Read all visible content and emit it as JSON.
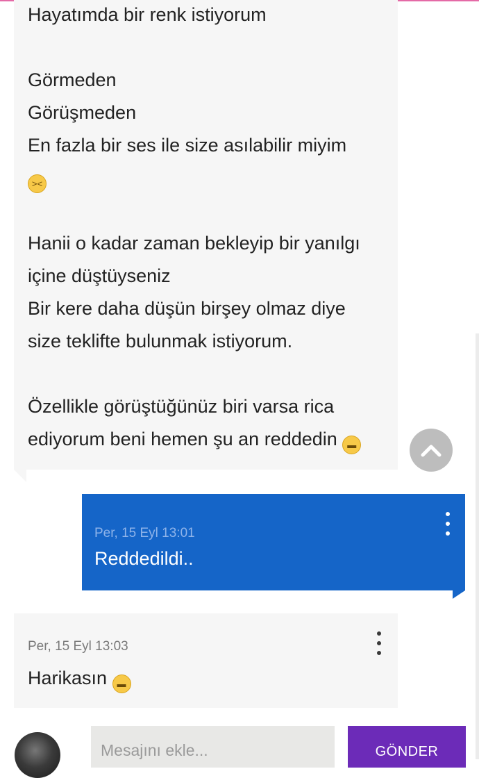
{
  "colors": {
    "accent_top": "#e46aa6",
    "incoming_bubble": "#f6f6f6",
    "outgoing_bubble": "#1565c8",
    "send_button": "#6c2bb8",
    "scroll_top_button": "#bdbdbd"
  },
  "messages": [
    {
      "direction": "incoming",
      "lines": [
        "Hayatımda bir renk istiyorum",
        "",
        "Görmeden",
        "Görüşmeden",
        "En fazla bir ses ile size asılabilir miyim",
        "😂",
        "",
        "Hanii o kadar zaman bekleyip bir yanılgı",
        "içine düştüyseniz",
        "Bir kere daha düşün birşey olmaz diye",
        "size teklifte bulunmak istiyorum.",
        "",
        "Özellikle görüştüğünüz biri varsa rica",
        "ediyorum beni hemen şu an reddedin 😁"
      ]
    },
    {
      "direction": "outgoing",
      "time": "Per, 15 Eyl 13:01",
      "text": "Reddedildi.."
    },
    {
      "direction": "incoming",
      "time": "Per, 15 Eyl 13:03",
      "text": "Harikasın 😁"
    }
  ],
  "icons": {
    "scroll_top": "chevron-up-icon",
    "message_menu": "more-vertical-icon",
    "emoji_tears": "face-with-tears-of-joy",
    "emoji_grin": "grinning-face"
  },
  "composer": {
    "placeholder": "Mesajını ekle...",
    "send_label": "GÖNDER"
  }
}
